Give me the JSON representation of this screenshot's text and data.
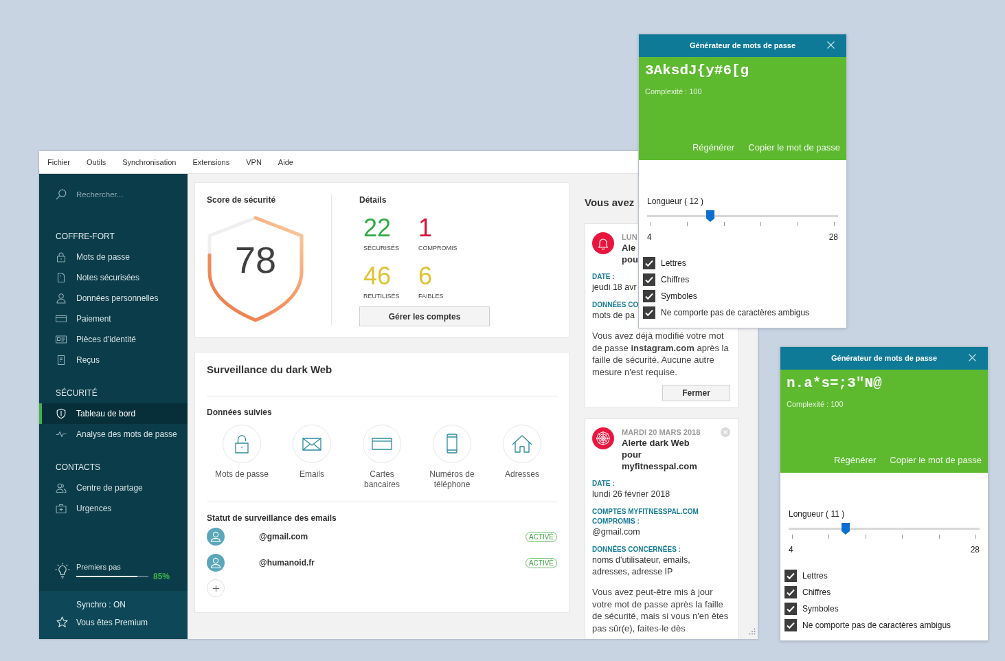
{
  "menu_bar": {
    "items": [
      "Fichier",
      "Outils",
      "Synchronisation",
      "Extensions",
      "VPN",
      "Aide"
    ]
  },
  "sidebar": {
    "search": {
      "placeholder": "Rechercher..."
    },
    "sections": [
      {
        "heading": "COFFRE-FORT",
        "items": [
          {
            "label": "Mots de passe",
            "selected": false
          },
          {
            "label": "Notes sécurisées",
            "selected": false
          },
          {
            "label": "Données personnelles",
            "selected": false
          },
          {
            "label": "Paiement",
            "selected": false
          },
          {
            "label": "Pièces d'identité",
            "selected": false
          },
          {
            "label": "Reçus",
            "selected": false
          }
        ]
      },
      {
        "heading": "SÉCURITÉ",
        "items": [
          {
            "label": "Tableau de bord",
            "selected": true
          },
          {
            "label": "Analyse des mots de passe",
            "selected": false
          }
        ]
      },
      {
        "heading": "CONTACTS",
        "items": [
          {
            "label": "Centre de partage",
            "selected": false
          },
          {
            "label": "Urgences",
            "selected": false
          }
        ]
      }
    ],
    "getting_started": {
      "label": "Premiers pas",
      "level": 0.85,
      "percent": "85%"
    },
    "footer": {
      "sync": "Synchro : ON",
      "premium": "Vous êtes Premium"
    }
  },
  "security_score": {
    "title": "Score de sécurité",
    "value": "78"
  },
  "details": {
    "title": "Détails",
    "stats": [
      {
        "value": "22",
        "label": "SÉCURISÉS",
        "color": "#2eab44"
      },
      {
        "value": "1",
        "label": "COMPROMIS",
        "color": "#d3123c"
      },
      {
        "value": "46",
        "label": "RÉUTILISÉS",
        "color": "#dfc332"
      },
      {
        "value": "6",
        "label": "FAIBLES",
        "color": "#dfc332"
      }
    ],
    "button": "Gérer les comptes"
  },
  "dark_web": {
    "title": "Surveillance du dark Web",
    "tracked_title": "Données suivies",
    "tracked": [
      "Mots de passe",
      "Emails",
      "Cartes bancaires",
      "Numéros de téléphone",
      "Adresses"
    ],
    "email_title": "Statut de surveillance des emails",
    "emails": [
      {
        "address": "@gmail.com",
        "status": "ACTIVÉ"
      },
      {
        "address": "@humanoid.fr",
        "status": "ACTIVÉ"
      }
    ]
  },
  "alerts": {
    "heading": "Vous avez",
    "items": [
      {
        "date": "LUN",
        "title": "Ale\npou",
        "fields": [
          {
            "label": "DATE :",
            "value": "jeudi 18 avr"
          },
          {
            "label": "DONNÉES CO",
            "value": "mots de pa"
          }
        ],
        "message": "Vous avez déjà modifié votre mot de passe **instagram.com** après la faille de sécurité. Aucune autre mesure n'est requise.",
        "button": "Fermer"
      },
      {
        "date": "MARDI 20 MARS 2018",
        "title": "Alerte dark Web pour myfitnesspal.com",
        "dismissible": true,
        "fields": [
          {
            "label": "DATE :",
            "value": "lundi 26 février 2018"
          },
          {
            "label": "COMPTES MYFITNESSPAL.COM COMPROMIS :",
            "value": "@gmail.com"
          },
          {
            "label": "DONNÉES CONCERNÉES :",
            "value": "noms d'utilisateur, emails, adresses, adresse IP"
          }
        ],
        "message": "Vous avez peut-être mis à jour votre mot de passe après la faille de sécurité, mais si vous n'en êtes pas sûr(e), faites-le dès"
      }
    ]
  },
  "generators": [
    {
      "title": "Générateur de mots de passe",
      "password": "3AksdJ{y#6[g",
      "complexity": "Complexité : 100",
      "actions": [
        "Régénérer",
        "Copier le mot de passe"
      ],
      "length_label": "Longueur ( 12 )",
      "level": 0.33,
      "min": "4",
      "max": "28",
      "options": [
        {
          "label": "Lettres",
          "checked": true
        },
        {
          "label": "Chiffres",
          "checked": true
        },
        {
          "label": "Symboles",
          "checked": true
        },
        {
          "label": "Ne comporte pas de caractères ambigus",
          "checked": true
        }
      ]
    },
    {
      "title": "Générateur de mots de passe",
      "password": "n.a*s=;3\"N@",
      "complexity": "Complexité : 100",
      "actions": [
        "Régénérer",
        "Copier le mot de passe"
      ],
      "length_label": "Longueur ( 11 )",
      "level": 0.3,
      "min": "4",
      "max": "28",
      "options": [
        {
          "label": "Lettres",
          "checked": true
        },
        {
          "label": "Chiffres",
          "checked": true
        },
        {
          "label": "Symboles",
          "checked": true
        },
        {
          "label": "Ne comporte pas de caractères ambigus",
          "checked": true
        }
      ]
    }
  ]
}
